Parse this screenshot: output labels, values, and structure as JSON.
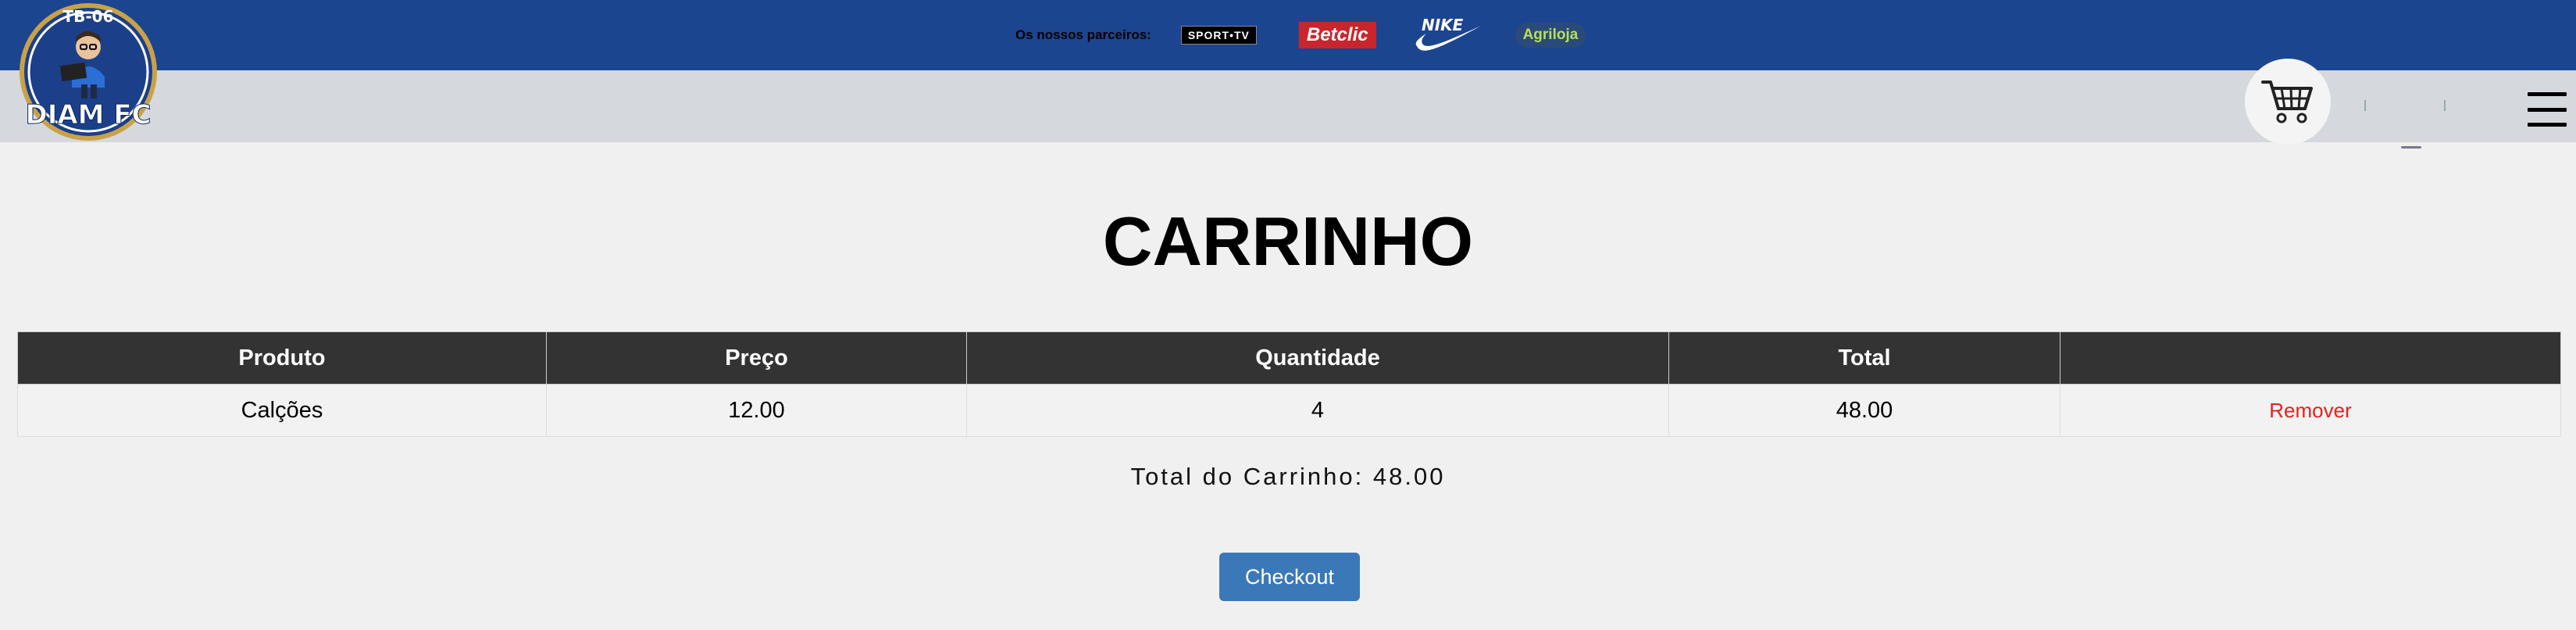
{
  "header": {
    "partners_label": "Os nossos parceiros:",
    "partners": [
      {
        "name": "SPORT•TV",
        "icon": "sporttv-logo"
      },
      {
        "name": "Betclic",
        "icon": "betclic-logo"
      },
      {
        "name": "NIKE",
        "icon": "nike-logo"
      },
      {
        "name": "Agriloja",
        "icon": "agriloja-logo"
      }
    ],
    "club_logo": {
      "top_text": "TB-06",
      "bottom_text": "DIAM FC",
      "icon": "club-crest-logo"
    },
    "actions": [
      {
        "icon": "shopping-cart-icon"
      },
      {
        "icon": "profile-avatar-icon"
      },
      {
        "icon": "hamburger-menu-icon"
      }
    ]
  },
  "page": {
    "title": "CARRINHO"
  },
  "table": {
    "headers": [
      "Produto",
      "Preço",
      "Quantidade",
      "Total",
      ""
    ],
    "rows": [
      {
        "produto": "Calções",
        "preco": "12.00",
        "quantidade": "4",
        "total": "48.00",
        "action": "Remover"
      }
    ]
  },
  "summary": {
    "total_text": "Total do Carrinho: 48.00"
  },
  "checkout_label": "Checkout",
  "colors": {
    "topbar": "#1c4590",
    "subbar": "#d5d9dd",
    "table_header": "#333333",
    "remove": "#e0241c",
    "checkout": "#3b78b7"
  }
}
